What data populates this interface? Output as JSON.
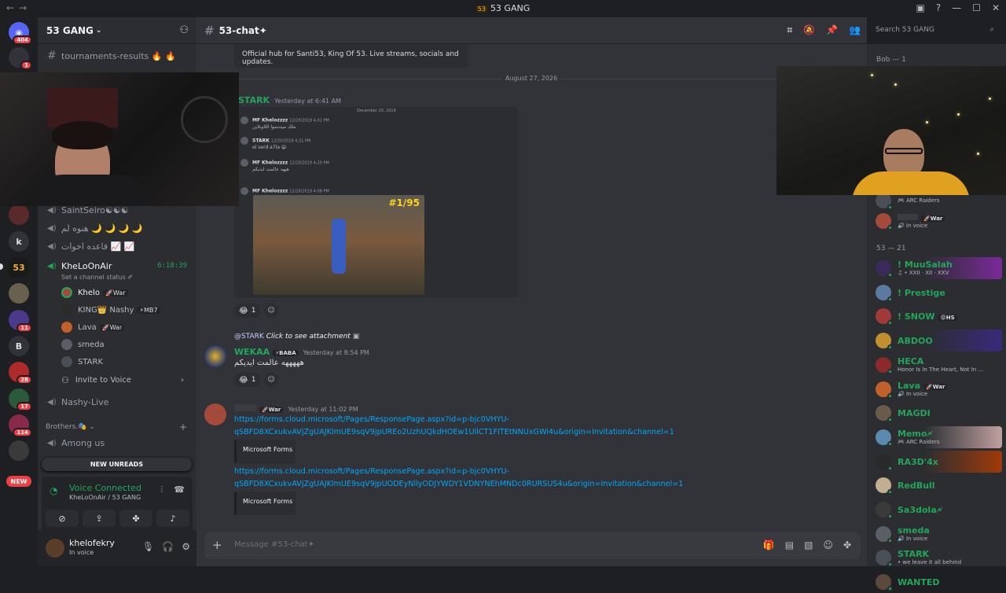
{
  "titlebar": {
    "title": "53 GANG",
    "badge": "53"
  },
  "guilds": [
    {
      "label": "",
      "count": "404",
      "color": "#313338"
    },
    {
      "label": "",
      "count": "1",
      "color": "#6a3a2a"
    },
    {
      "label": "k",
      "count": "",
      "color": "#313338"
    },
    {
      "label": "53",
      "count": "",
      "color": "#2b2d31"
    },
    {
      "label": "B",
      "count": "",
      "color": "#313338"
    },
    {
      "label": "",
      "count": "28",
      "color": "#b02a2a"
    },
    {
      "label": "",
      "count": "17",
      "color": "#2a5a3a"
    },
    {
      "label": "",
      "count": "114",
      "color": "#8a2a4a"
    },
    {
      "label": "",
      "count": "11",
      "color": "#4a3a8a"
    }
  ],
  "new_pill": "NEW",
  "server": {
    "name": "53 GANG"
  },
  "channels": {
    "top_channel": "tournaments-results 🔥 🔥",
    "voice_channels": [
      {
        "name": "SaintSeiro☯☯☯"
      },
      {
        "name": "هنوه لم 🌙 🌙 🌙 🌙"
      },
      {
        "name": "قاعده اخوات 📈 📈"
      }
    ],
    "active_voice": {
      "name": "KheLoOnAir",
      "timer": "6:18:39",
      "status": "Set a channel status ✐"
    },
    "voice_users": [
      {
        "name": "Khelo",
        "tag": "🚀War",
        "color": "#a34a3a"
      },
      {
        "name": "KING👑 Nashy",
        "tag": "⚡MB7",
        "color": "#2a2a2a"
      },
      {
        "name": "Lava",
        "tag": "🚀War",
        "color": "#c0602a"
      },
      {
        "name": "smeda",
        "tag": "",
        "color": "#5a5e66"
      },
      {
        "name": "STARK",
        "tag": "",
        "color": "#4a4e56"
      }
    ],
    "invite_to_voice": "Invite to Voice",
    "nashy_live": "Nashy-Live",
    "category": "Brothers.🎭 ⌄",
    "among_us": "Among us"
  },
  "new_unreads": "NEW UNREADS",
  "voice_connected": {
    "title": "Voice Connected",
    "sub": "KheLoOnAir / 53 GANG"
  },
  "user": {
    "name": "khelofekry",
    "status": "In voice"
  },
  "chat": {
    "channel_name": "53-chat✦",
    "embed_top_text": "Official hub for Santi53, King Of 53. Live streams, socials and updates.",
    "date_divider": "August 27, 2026",
    "msg1": {
      "author": "STARK",
      "time": "Yesterday at 6:41 AM"
    },
    "attachment": {
      "date_label": "December 20, 2019",
      "lines": [
        {
          "name": "MF Khelozzzz",
          "time": "12/20/2019 4:01 PM",
          "text": "ملك ميندسوا اللاونلاين"
        },
        {
          "name": "STARK",
          "time": "12/20/2019 4:21 PM",
          "text": "el serd a7la 😄"
        },
        {
          "name": "MF Khelozzzz",
          "time": "12/20/2019 4:20 PM",
          "text": "هيهه\nعالمت ايديكم"
        },
        {
          "name": "MF Khelozzzz",
          "time": "12/20/2019 4:08 PM",
          "text": ""
        }
      ],
      "rank": "#1/95"
    },
    "reaction1": {
      "emoji": "😂",
      "count": "1"
    },
    "reply": {
      "mention": "@STARK",
      "text": "Click to see attachment"
    },
    "msg2": {
      "author": "WEKAA",
      "role": "⚡BABA",
      "time": "Yesterday at 8:54 PM",
      "text": "هههههه عالمت ايديكم"
    },
    "reaction2": {
      "emoji": "😂",
      "count": "1"
    },
    "msg3": {
      "role": "🚀War",
      "time": "Yesterday at 11:02 PM"
    },
    "link1": "https://forms.cloud.microsoft/Pages/ResponsePage.aspx?id=p-bjc0VHYU-qSBFD8XCxukvAVjZgUAJKlmUE9sqV9jpUREo2UzhUQkdHOEw1UllCT1FITEtNNUxGWi4u&origin=Invitation&channel=1",
    "embed1": "Microsoft Forms",
    "link2": "https://forms.cloud.microsoft/Pages/ResponsePage.aspx?id=p-bjc0VHYU-qSBFD8XCxukvAVjZgUAJKlmUE9sqV9jpUODEyNllyODJYWDY1VDNYNEhMNDc0RURSUS4u&origin=Invitation&channel=1",
    "embed2": "Microsoft Forms",
    "composer_placeholder": "Message #53-chat✦"
  },
  "search": {
    "placeholder": "Search 53 GANG"
  },
  "members": {
    "group1": "Bob — 1",
    "group1_members": [
      {
        "name": "",
        "sub": "🎮 ARC Raiders",
        "tag": "",
        "color": "#4a4e56"
      },
      {
        "name": "",
        "sub": "🔊 In voice",
        "tag": "🚀War",
        "color": "#a34a3a"
      }
    ],
    "group2": "53 — 21",
    "group2_members": [
      {
        "name": "! MuuSalah",
        "sub": "♫ • XXII · XII · XXV",
        "tag": "",
        "color": "#3a2a5a",
        "bg": "linear-gradient(90deg,#2b2d31 40%,#7a2a9a)"
      },
      {
        "name": "! Prestige",
        "sub": "",
        "tag": "",
        "color": "#5a7aa0",
        "bg": ""
      },
      {
        "name": "! SNOW",
        "sub": "",
        "tag": "😡HS",
        "color": "#a03a3a",
        "bg": ""
      },
      {
        "name": "ABDOO",
        "sub": "",
        "tag": "",
        "color": "#c09030",
        "bg": "linear-gradient(90deg,#2b2d31 40%,#3a2a7a)"
      },
      {
        "name": "HECA",
        "sub": "Honor Is In The Heart, Not In ...",
        "tag": "",
        "color": "#8a2a2a",
        "bg": ""
      },
      {
        "name": "Lava",
        "sub": "🔊 In voice",
        "tag": "🚀War",
        "color": "#c0602a",
        "bg": ""
      },
      {
        "name": "MAGDI",
        "sub": "",
        "tag": "",
        "color": "#6a5a4a",
        "bg": ""
      },
      {
        "name": "Memo🗲",
        "sub": "🎮 ARC Raiders",
        "tag": "",
        "color": "#5a8ab0",
        "bg": "linear-gradient(90deg,#2b2d31 40%,#c0a0a0)"
      },
      {
        "name": "RA3D'4x",
        "sub": "",
        "tag": "",
        "color": "#2a2a2a",
        "bg": "linear-gradient(90deg,#2b2d31 40%,#a03a0a)"
      },
      {
        "name": "RedBull",
        "sub": "",
        "tag": "",
        "color": "#c0b090",
        "bg": ""
      },
      {
        "name": "Sa3dola🗲",
        "sub": "",
        "tag": "",
        "color": "#3a3a3a",
        "bg": ""
      },
      {
        "name": "smeda",
        "sub": "🔊 In voice",
        "tag": "",
        "color": "#5a5e66",
        "bg": ""
      },
      {
        "name": "STARK",
        "sub": "• we leave it all behind",
        "tag": "",
        "color": "#4a4e56",
        "bg": ""
      },
      {
        "name": "WANTED",
        "sub": "",
        "tag": "",
        "color": "#5a4a3a",
        "bg": ""
      }
    ]
  },
  "colors": {
    "online": "#23a55a",
    "link": "#00a8fc",
    "danger": "#f23f43"
  }
}
